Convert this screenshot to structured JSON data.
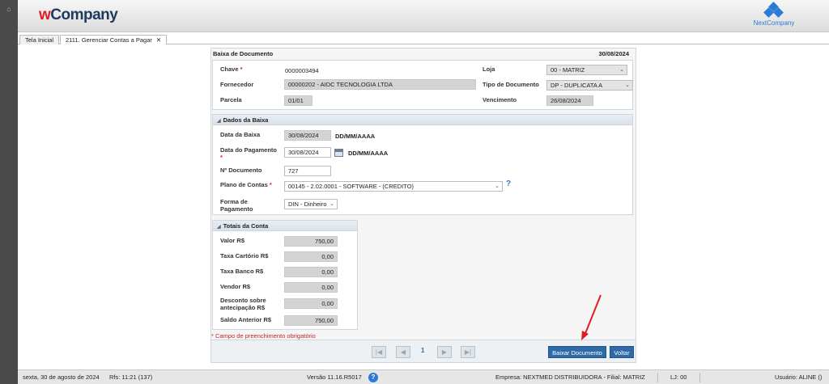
{
  "brand": {
    "logo_w": "w",
    "logo_rest": "Company",
    "partner": "NextCompany"
  },
  "tabs": [
    {
      "label": "Tela Inicial"
    },
    {
      "label": "2111. Gerenciar Contas a Pagar"
    }
  ],
  "panel": {
    "title": "Baixa de Documento",
    "date": "30/08/2024"
  },
  "document": {
    "chave_label": "Chave",
    "chave_value": "0000003494",
    "fornecedor_label": "Fornecedor",
    "fornecedor_value": "00000202 - AIDC TECNOLOGIA LTDA",
    "parcela_label": "Parcela",
    "parcela_value": "01/01",
    "loja_label": "Loja",
    "loja_value": "00 - MATRIZ",
    "tipo_label": "Tipo de Documento",
    "tipo_value": "DP - DUPLICATA A",
    "vencimento_label": "Vencimento",
    "vencimento_value": "26/08/2024"
  },
  "baixa": {
    "section": "Dados da Baixa",
    "data_baixa_label": "Data da Baixa",
    "data_baixa_value": "30/08/2024",
    "data_pagamento_label": "Data do Pagamento",
    "data_pagamento_value": "30/08/2024",
    "date_format": "DD/MM/AAAA",
    "num_doc_label": "Nº Documento",
    "num_doc_value": "727",
    "plano_label": "Plano de Contas",
    "plano_value": "00145 - 2.02.0001 - SOFTWARE - (CREDITO)",
    "forma_label_1": "Forma de",
    "forma_label_2": "Pagamento",
    "forma_value": "DIN - Dinheiro",
    "help": "?"
  },
  "totais": {
    "section": "Totais da Conta",
    "rows": [
      {
        "label": "Valor R$",
        "value": "750,00"
      },
      {
        "label": "Taxa Cartório R$",
        "value": "0,00"
      },
      {
        "label": "Taxa Banco R$",
        "value": "0,00"
      },
      {
        "label": "Vendor R$",
        "value": "0,00"
      },
      {
        "label": "Desconto sobre",
        "label2": "antecipação R$",
        "value": "0,00"
      },
      {
        "label": "Saldo Anterior R$",
        "value": "750,00"
      }
    ]
  },
  "required_note": "Campo de preenchimento obrigatório",
  "required_star": "*",
  "pager": {
    "page": "1"
  },
  "actions": {
    "baixar": "Baixar Documento",
    "voltar": "Voltar"
  },
  "status": {
    "date": "sexta, 30 de agosto de 2024",
    "rfs": "Rfs: 11:21 (137)",
    "version": "Versão 11.16.R5017",
    "empresa": "Empresa: NEXTMED DISTRIBUIDORA - Filial: MATRIZ",
    "lj": "LJ: 00",
    "usuario": "Usuário: ALINE ()"
  },
  "colors": {
    "accent": "#2f6aa8",
    "required": "#c0282b",
    "arrow": "#e01b24"
  }
}
